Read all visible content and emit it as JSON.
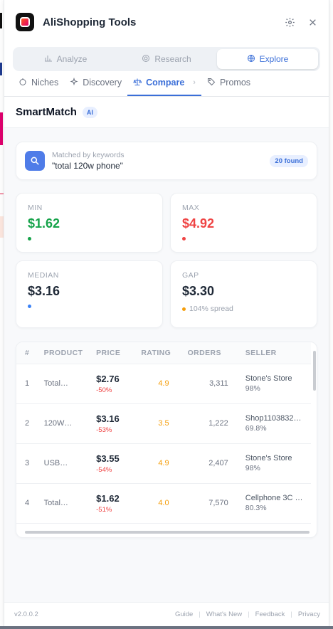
{
  "app": {
    "title": "AliShopping Tools"
  },
  "header": {
    "settings_icon": "gear-icon",
    "close_icon": "close-icon"
  },
  "modes": [
    {
      "label": "Analyze",
      "icon": "bar-chart-icon",
      "active": false
    },
    {
      "label": "Research",
      "icon": "target-icon",
      "active": false
    },
    {
      "label": "Explore",
      "icon": "globe-icon",
      "active": true
    }
  ],
  "subtabs": [
    {
      "label": "Niches",
      "icon": "tag-icon"
    },
    {
      "label": "Discovery",
      "icon": "sparkle-icon"
    },
    {
      "label": "Compare",
      "icon": "scale-icon",
      "active": true
    },
    {
      "label": "Promos",
      "icon": "label-icon"
    }
  ],
  "section": {
    "title": "SmartMatch",
    "badge": "AI"
  },
  "match": {
    "label": "Matched by keywords",
    "query": "\"total 120w phone\"",
    "found": "20 found"
  },
  "stats": {
    "min": {
      "label": "MIN",
      "value": "$1.62",
      "color": "#16a34a"
    },
    "max": {
      "label": "MAX",
      "value": "$4.92",
      "color": "#ef4444"
    },
    "median": {
      "label": "MEDIAN",
      "value": "$3.16",
      "color": "#3b82f6"
    },
    "gap": {
      "label": "GAP",
      "value": "$3.30",
      "note": "104% spread",
      "color": "#f59e0b"
    }
  },
  "table": {
    "headers": {
      "num": "#",
      "product": "PRODUCT",
      "price": "PRICE",
      "rating": "RATING",
      "orders": "ORDERS",
      "seller": "SELLER"
    },
    "rows": [
      {
        "num": "1",
        "product": "Total…",
        "price": "$2.76",
        "discount": "-50%",
        "rating": "4.9",
        "orders": "3,311",
        "seller": "Stone's Store",
        "seller_rate": "98%"
      },
      {
        "num": "2",
        "product": "120W…",
        "price": "$3.16",
        "discount": "-53%",
        "rating": "3.5",
        "orders": "1,222",
        "seller": "Shop1103832…",
        "seller_rate": "69.8%"
      },
      {
        "num": "3",
        "product": "USB…",
        "price": "$3.55",
        "discount": "-54%",
        "rating": "4.9",
        "orders": "2,407",
        "seller": "Stone's Store",
        "seller_rate": "98%"
      },
      {
        "num": "4",
        "product": "Total…",
        "price": "$1.62",
        "discount": "-51%",
        "rating": "4.0",
        "orders": "7,570",
        "seller": "Cellphone 3C …",
        "seller_rate": "80.3%"
      }
    ]
  },
  "footer": {
    "version": "v2.0.0.2",
    "links": [
      "Guide",
      "What's New",
      "Feedback",
      "Privacy"
    ]
  }
}
